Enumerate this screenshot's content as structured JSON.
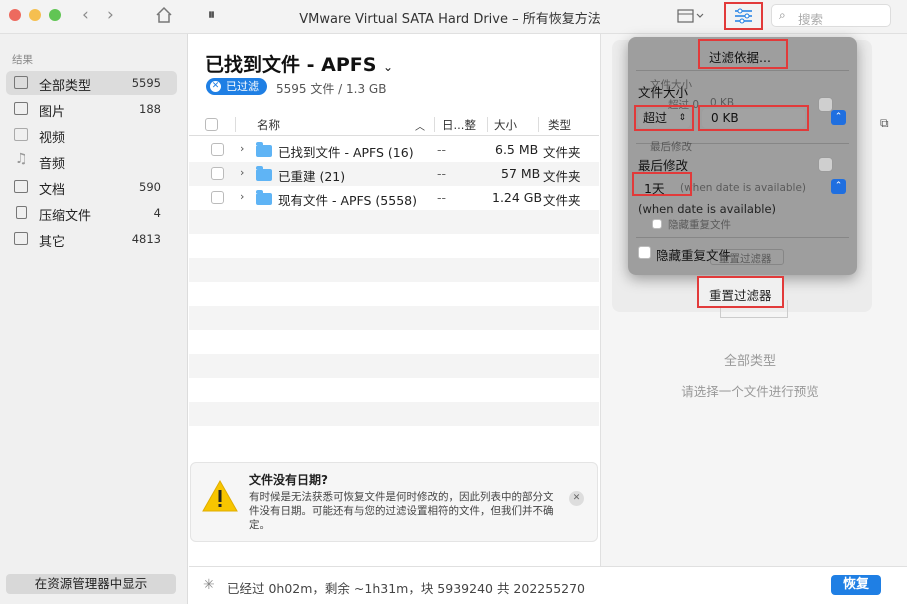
{
  "window": {
    "title": "VMware Virtual SATA Hard Drive – 所有恢复方法",
    "search_placeholder": "搜索"
  },
  "sidebar": {
    "section_label": "结果",
    "items": [
      {
        "label": "全部类型",
        "count": "5595"
      },
      {
        "label": "图片",
        "count": "188"
      },
      {
        "label": "视频",
        "count": ""
      },
      {
        "label": "音频",
        "count": ""
      },
      {
        "label": "文档",
        "count": "590"
      },
      {
        "label": "压缩文件",
        "count": "4"
      },
      {
        "label": "其它",
        "count": "4813"
      }
    ],
    "show_in_explorer": "在资源管理器中显示"
  },
  "main": {
    "title": "已找到文件 - APFS",
    "filter_badge": "已过滤",
    "summary": "5595 文件 / 1.3 GB",
    "columns": {
      "name": "名称",
      "date": "日...整",
      "size": "大小",
      "type": "类型"
    },
    "rows": [
      {
        "name": "已找到文件 - APFS (16)",
        "date": "--",
        "size": "6.5 MB",
        "type": "文件夹"
      },
      {
        "name": "已重建 (21)",
        "date": "--",
        "size": "57 MB",
        "type": "文件夹"
      },
      {
        "name": "现有文件 - APFS (5558)",
        "date": "--",
        "size": "1.24 GB",
        "type": "文件夹"
      }
    ]
  },
  "banner": {
    "title": "文件没有日期?",
    "text": "有时候是无法获悉可恢复文件是何时修改的，因此列表中的部分文件没有日期。可能还有与您的过滤设置相符的文件，但我们并不确定。"
  },
  "footer": {
    "status": "已经过 0h02m，剩余 ~1h31m，块 5939240 共 202255270",
    "recover": "恢复"
  },
  "preview": {
    "title": "全部类型",
    "hint": "请选择一个文件进行预览"
  },
  "filter_popover": {
    "title": "过滤依据...",
    "ghost_size": "文件大小",
    "ghost_over": "超过 0",
    "ghost_kb": "0 KB",
    "size_label": "文件大小",
    "size_operator": "超过",
    "size_value": "0 KB",
    "ghost_modified": "最后修改",
    "modified_label": "最后修改",
    "modified_value": "1天",
    "ghost_when": "(when date is available)",
    "when_note": "(when date is available)",
    "ghost_hide": "隐藏重复文件",
    "hide_duplicates": "隐藏重复文件",
    "ghost_reset": "重置过滤器",
    "reset": "重置过滤器"
  },
  "colors": {
    "accent": "#1f7fe4",
    "highlight": "#e23a3a",
    "folder": "#5fb4f5"
  }
}
